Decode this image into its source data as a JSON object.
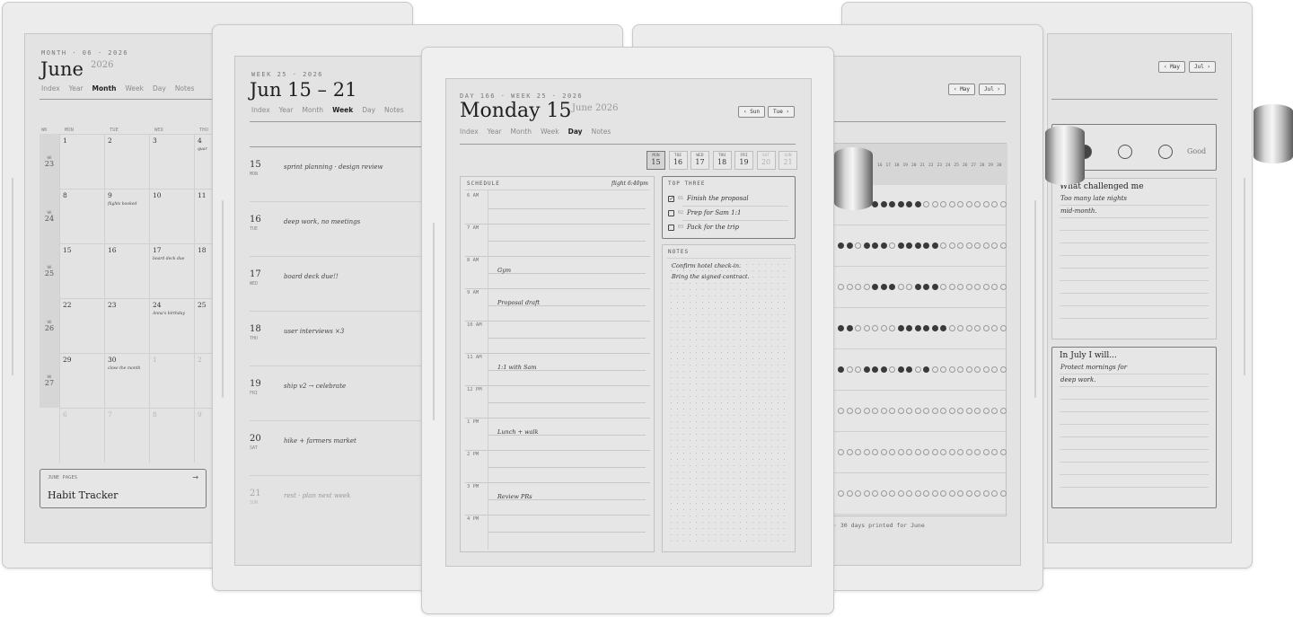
{
  "month_view": {
    "eyebrow": "MONTH · 06 · 2026",
    "title": "June",
    "year": "2026",
    "nav": [
      "Index",
      "Year",
      "Month",
      "Week",
      "Day",
      "Notes"
    ],
    "active_nav": "Month",
    "headers": [
      "WK",
      "MON",
      "TUE",
      "WED",
      "THU"
    ],
    "weeks": [
      {
        "wk_label": "WK",
        "wk": "23",
        "days": [
          {
            "d": "1"
          },
          {
            "d": "2"
          },
          {
            "d": "3"
          },
          {
            "d": "4",
            "note": "quar"
          }
        ]
      },
      {
        "wk_label": "WK",
        "wk": "24",
        "days": [
          {
            "d": "8"
          },
          {
            "d": "9",
            "note": "flights booked"
          },
          {
            "d": "10"
          },
          {
            "d": "11"
          }
        ]
      },
      {
        "wk_label": "WK",
        "wk": "25",
        "days": [
          {
            "d": "15"
          },
          {
            "d": "16"
          },
          {
            "d": "17",
            "note": "board deck due"
          },
          {
            "d": "18"
          }
        ]
      },
      {
        "wk_label": "WK",
        "wk": "26",
        "days": [
          {
            "d": "22"
          },
          {
            "d": "23"
          },
          {
            "d": "24",
            "note": "Anna's birthday"
          },
          {
            "d": "25"
          }
        ]
      },
      {
        "wk_label": "WK",
        "wk": "27",
        "days": [
          {
            "d": "29"
          },
          {
            "d": "30",
            "note": "close the month"
          },
          {
            "d": "1",
            "dim": true
          },
          {
            "d": "2",
            "dim": true
          }
        ]
      },
      {
        "wk_label": "",
        "wk": "",
        "days": [
          {
            "d": "6",
            "dim": true
          },
          {
            "d": "7",
            "dim": true
          },
          {
            "d": "8",
            "dim": true
          },
          {
            "d": "9",
            "dim": true
          }
        ]
      }
    ],
    "pages_label": "JUNE PAGES",
    "pages_arrow": "→",
    "pages_title": "Habit Tracker"
  },
  "week_view": {
    "eyebrow": "WEEK 25 · 2026",
    "title": "Jun 15 – 21",
    "nav": [
      "Index",
      "Year",
      "Month",
      "Week",
      "Day",
      "Notes"
    ],
    "active_nav": "Week",
    "days": [
      {
        "num": "15",
        "dow": "MON",
        "text": "sprint planning · design review"
      },
      {
        "num": "16",
        "dow": "TUE",
        "text": "deep work, no meetings"
      },
      {
        "num": "17",
        "dow": "WED",
        "text": "board deck due!!"
      },
      {
        "num": "18",
        "dow": "THU",
        "text": "user interviews ×3"
      },
      {
        "num": "19",
        "dow": "FRI",
        "text": "ship v2 → celebrate"
      },
      {
        "num": "20",
        "dow": "SAT",
        "text": "hike + farmers market"
      },
      {
        "num": "21",
        "dow": "SUN",
        "text": "rest · plan next week",
        "faded": true
      }
    ]
  },
  "day_view": {
    "eyebrow": "DAY 166 · WEEK 25 · 2026",
    "title": "Monday 15",
    "subtitle": "June 2026",
    "prev_btn": "‹ Sun",
    "next_btn": "Tue ›",
    "nav": [
      "Index",
      "Year",
      "Month",
      "Week",
      "Day",
      "Notes"
    ],
    "active_nav": "Day",
    "strip": [
      {
        "dow": "MON",
        "num": "15",
        "active": true
      },
      {
        "dow": "TUE",
        "num": "16"
      },
      {
        "dow": "WED",
        "num": "17"
      },
      {
        "dow": "THU",
        "num": "18"
      },
      {
        "dow": "FRI",
        "num": "19"
      },
      {
        "dow": "SAT",
        "num": "20",
        "faded": true
      },
      {
        "dow": "SUN",
        "num": "21",
        "faded": true
      }
    ],
    "schedule_label": "SCHEDULE",
    "schedule_note": "flight 6:40pm",
    "hours": [
      {
        "label": "6 AM",
        "event": ""
      },
      {
        "label": "7 AM",
        "event": ""
      },
      {
        "label": "8 AM",
        "event": "Gym"
      },
      {
        "label": "9 AM",
        "event": "Proposal draft"
      },
      {
        "label": "10 AM",
        "event": ""
      },
      {
        "label": "11 AM",
        "event": "1:1 with Sam"
      },
      {
        "label": "12 PM",
        "event": ""
      },
      {
        "label": "1 PM",
        "event": "Lunch + walk"
      },
      {
        "label": "2 PM",
        "event": ""
      },
      {
        "label": "3 PM",
        "event": "Review PRs"
      },
      {
        "label": "4 PM",
        "event": ""
      }
    ],
    "top_three_label": "TOP THREE",
    "top_three": [
      {
        "n": "01",
        "text": "Finish the proposal",
        "done": true
      },
      {
        "n": "02",
        "text": "Prep for Sam 1:1",
        "done": false
      },
      {
        "n": "03",
        "text": "Pack for the trip",
        "done": false
      }
    ],
    "notes_label": "NOTES",
    "notes": [
      "Confirm hotel check-in.",
      "Bring the signed contract."
    ]
  },
  "habit_view": {
    "prev_btn": "‹ May",
    "next_btn": "Jul ›",
    "day_numbers": [
      "16",
      "17",
      "18",
      "19",
      "20",
      "21",
      "22",
      "23",
      "24",
      "25",
      "26",
      "27",
      "28",
      "29",
      "30"
    ],
    "rows": [
      [
        0,
        0,
        0,
        1,
        1,
        1,
        1,
        1,
        1,
        1,
        0,
        0,
        0,
        0,
        0,
        0,
        0,
        0,
        0,
        0
      ],
      [
        1,
        1,
        0,
        1,
        1,
        1,
        0,
        1,
        1,
        1,
        1,
        1,
        0,
        0,
        0,
        0,
        0,
        0,
        0,
        0
      ],
      [
        0,
        0,
        0,
        0,
        1,
        1,
        1,
        0,
        0,
        1,
        1,
        1,
        0,
        0,
        0,
        0,
        0,
        0,
        0,
        0
      ],
      [
        1,
        1,
        0,
        0,
        0,
        0,
        0,
        1,
        1,
        1,
        1,
        1,
        1,
        0,
        0,
        0,
        0,
        0,
        0,
        0
      ],
      [
        1,
        0,
        0,
        1,
        1,
        1,
        0,
        1,
        1,
        0,
        1,
        0,
        0,
        0,
        0,
        0,
        0,
        0,
        0,
        0
      ],
      [
        0,
        0,
        0,
        0,
        0,
        0,
        0,
        0,
        0,
        0,
        0,
        0,
        0,
        0,
        0,
        0,
        0,
        0,
        0,
        0
      ],
      [
        0,
        0,
        0,
        0,
        0,
        0,
        0,
        0,
        0,
        0,
        0,
        0,
        0,
        0,
        0,
        0,
        0,
        0,
        0,
        0
      ],
      [
        0,
        0,
        0,
        0,
        0,
        0,
        0,
        0,
        0,
        0,
        0,
        0,
        0,
        0,
        0,
        0,
        0,
        0,
        0,
        0
      ]
    ],
    "footer": "· 30 days printed for June"
  },
  "review_view": {
    "prev_btn": "‹ May",
    "next_btn": "Jul ›",
    "mood_label": "Good",
    "challenged_head": "What challenged me",
    "challenged_lines": [
      "Too many late nights",
      "mid-month."
    ],
    "july_head": "In July I will...",
    "july_lines": [
      "Protect mornings for",
      "deep work."
    ]
  }
}
